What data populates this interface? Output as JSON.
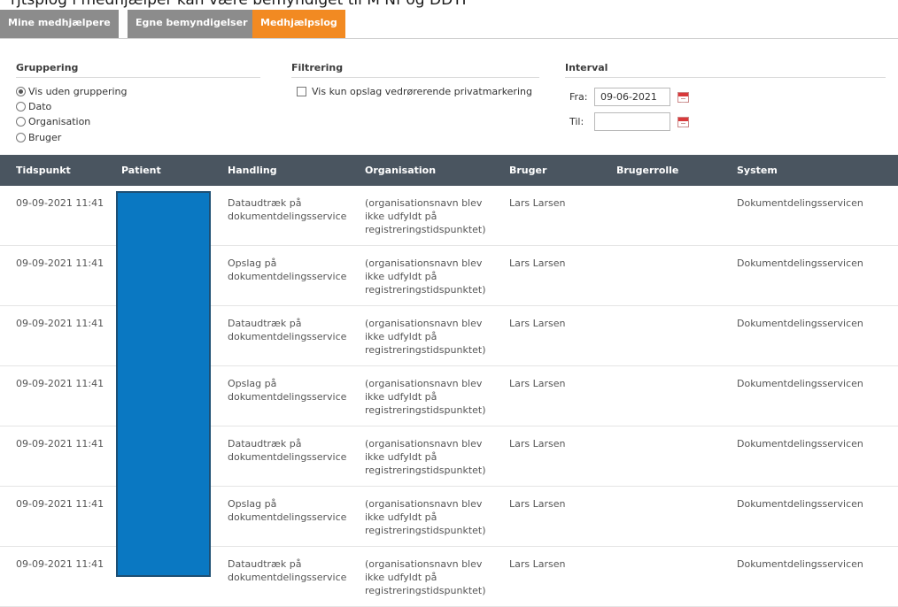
{
  "caption": "rjtsplog i medhjælper kan være bemyndiget til M Nf og DDTF",
  "tabs": [
    {
      "label": "Mine medhjælpere",
      "active": false
    },
    {
      "label": "Egne bemyndigelser",
      "active": false
    },
    {
      "label": "Medhjælpslog",
      "active": true
    }
  ],
  "grouping": {
    "title": "Gruppering",
    "options": [
      "Vis uden gruppering",
      "Dato",
      "Organisation",
      "Bruger"
    ],
    "selected": "Vis uden gruppering"
  },
  "filter": {
    "title": "Filtrering",
    "checkbox_label": "Vis kun opslag vedrørerende privatmarkering",
    "checked": false
  },
  "interval": {
    "title": "Interval",
    "from_label": "Fra:",
    "from_value": "09-06-2021",
    "to_label": "Til:",
    "to_value": ""
  },
  "table": {
    "columns": [
      "Tidspunkt",
      "Patient",
      "Handling",
      "Organisation",
      "Bruger",
      "Brugerrolle",
      "System"
    ],
    "rows": [
      {
        "time": "09-09-2021 11:41",
        "action_l1": "Dataudtræk på",
        "action_l2": "dokumentdelingsservice",
        "org_l1": "(organisationsnavn blev",
        "org_l2": "ikke udfyldt på",
        "org_l3": "registreringstidspunktet)",
        "user": "Lars Larsen",
        "role": "",
        "system": "Dokumentdelingsservicen"
      },
      {
        "time": "09-09-2021 11:41",
        "action_l1": "Opslag på",
        "action_l2": "dokumentdelingsservice",
        "org_l1": "(organisationsnavn blev",
        "org_l2": "ikke udfyldt på",
        "org_l3": "registreringstidspunktet)",
        "user": "Lars Larsen",
        "role": "",
        "system": "Dokumentdelingsservicen"
      },
      {
        "time": "09-09-2021 11:41",
        "action_l1": "Dataudtræk på",
        "action_l2": "dokumentdelingsservice",
        "org_l1": "(organisationsnavn blev",
        "org_l2": "ikke udfyldt på",
        "org_l3": "registreringstidspunktet)",
        "user": "Lars Larsen",
        "role": "",
        "system": "Dokumentdelingsservicen"
      },
      {
        "time": "09-09-2021 11:41",
        "action_l1": "Opslag på",
        "action_l2": "dokumentdelingsservice",
        "org_l1": "(organisationsnavn blev",
        "org_l2": "ikke udfyldt på",
        "org_l3": "registreringstidspunktet)",
        "user": "Lars Larsen",
        "role": "",
        "system": "Dokumentdelingsservicen"
      },
      {
        "time": "09-09-2021 11:41",
        "action_l1": "Dataudtræk på",
        "action_l2": "dokumentdelingsservice",
        "org_l1": "(organisationsnavn blev",
        "org_l2": "ikke udfyldt på",
        "org_l3": "registreringstidspunktet)",
        "user": "Lars Larsen",
        "role": "",
        "system": "Dokumentdelingsservicen"
      },
      {
        "time": "09-09-2021 11:41",
        "action_l1": "Opslag på",
        "action_l2": "dokumentdelingsservice",
        "org_l1": "(organisationsnavn blev",
        "org_l2": "ikke udfyldt på",
        "org_l3": "registreringstidspunktet)",
        "user": "Lars Larsen",
        "role": "",
        "system": "Dokumentdelingsservicen"
      },
      {
        "time": "09-09-2021 11:41",
        "action_l1": "Dataudtræk på",
        "action_l2": "dokumentdelingsservice",
        "org_l1": "(organisationsnavn blev",
        "org_l2": "ikke udfyldt på",
        "org_l3": "registreringstidspunktet)",
        "user": "Lars Larsen",
        "role": "",
        "system": "Dokumentdelingsservicen"
      }
    ]
  },
  "colors": {
    "tab_active": "#f28a22",
    "tab_inactive": "#8c8c8c",
    "table_header": "#4a5560",
    "redaction": "#0a78c2"
  }
}
